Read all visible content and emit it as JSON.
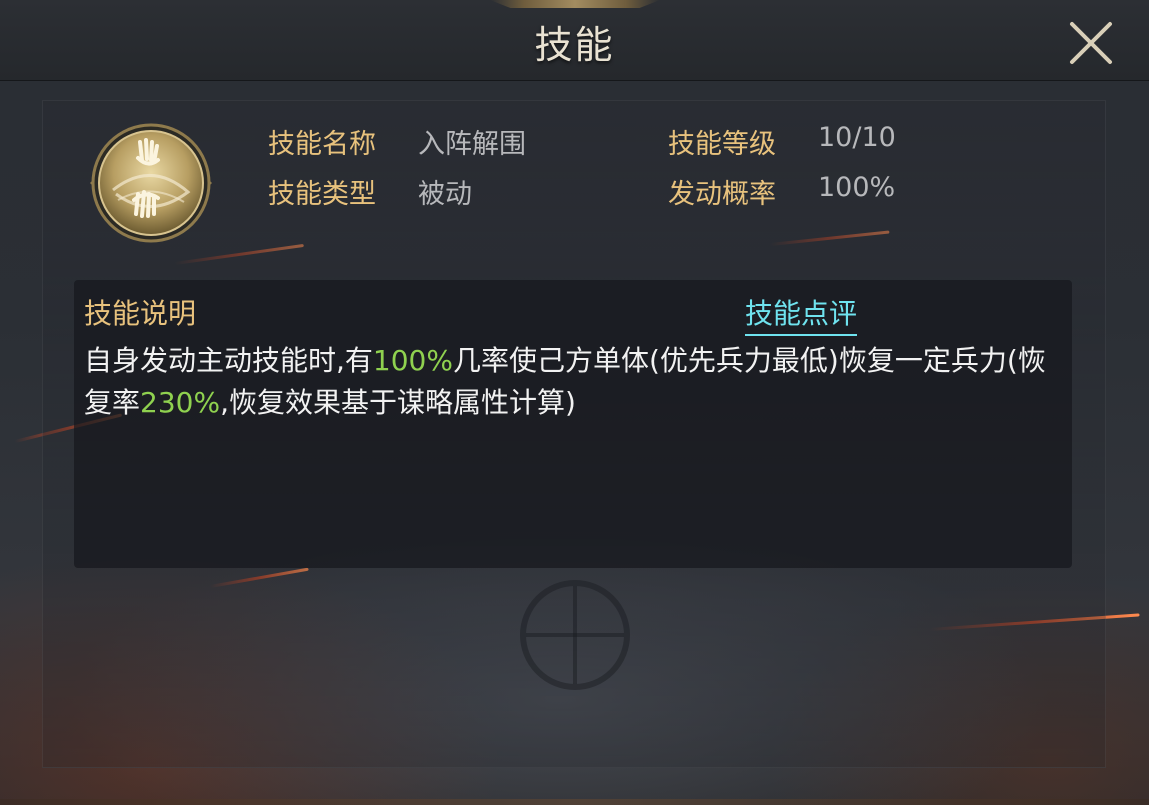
{
  "window": {
    "title": "技能",
    "close_icon": "close-icon"
  },
  "skill": {
    "icon": "hand-swirl-icon",
    "name_label": "技能名称",
    "name_value": "入阵解围",
    "level_label": "技能等级",
    "level_value": "10/10",
    "type_label": "技能类型",
    "type_value": "被动",
    "rate_label": "发动概率",
    "rate_value": "100%"
  },
  "description": {
    "header": "技能说明",
    "review_link": "技能点评",
    "part1": "自身发动主动技能时,有",
    "highlight1": "100%",
    "part2": "几率使己方单体(优先兵力最低)恢复一定兵力(恢复率",
    "highlight2": "230%",
    "part3": ",恢复效果基于谋略属性计算)"
  },
  "colors": {
    "label_gold": "#e8c27d",
    "value_gray": "#b7b8bb",
    "highlight_green": "#8fd14f",
    "link_cyan": "#6fe3ef"
  }
}
